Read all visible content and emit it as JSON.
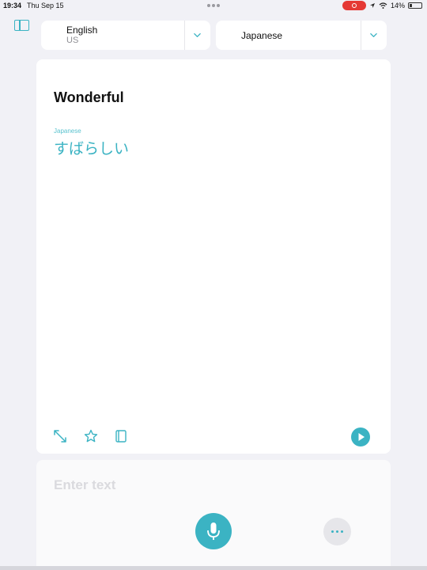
{
  "status_bar": {
    "time": "19:34",
    "date": "Thu Sep 15",
    "battery": "14%"
  },
  "source_language": {
    "name": "English",
    "region": "US"
  },
  "target_language": {
    "name": "Japanese"
  },
  "translation_card": {
    "source_text": "Wonderful",
    "target_language_label": "Japanese",
    "translation": "すばらしい"
  },
  "input": {
    "placeholder": "Enter text"
  },
  "colors": {
    "accent": "#3bb3c3",
    "background": "#f1f1f6",
    "recording": "#e53935"
  },
  "icons": {
    "sidebar": "sidebar-icon",
    "expand": "expand-icon",
    "favorite": "star-icon",
    "dictionary": "book-icon",
    "play": "play-icon",
    "microphone": "microphone-icon",
    "more": "ellipsis-icon"
  }
}
